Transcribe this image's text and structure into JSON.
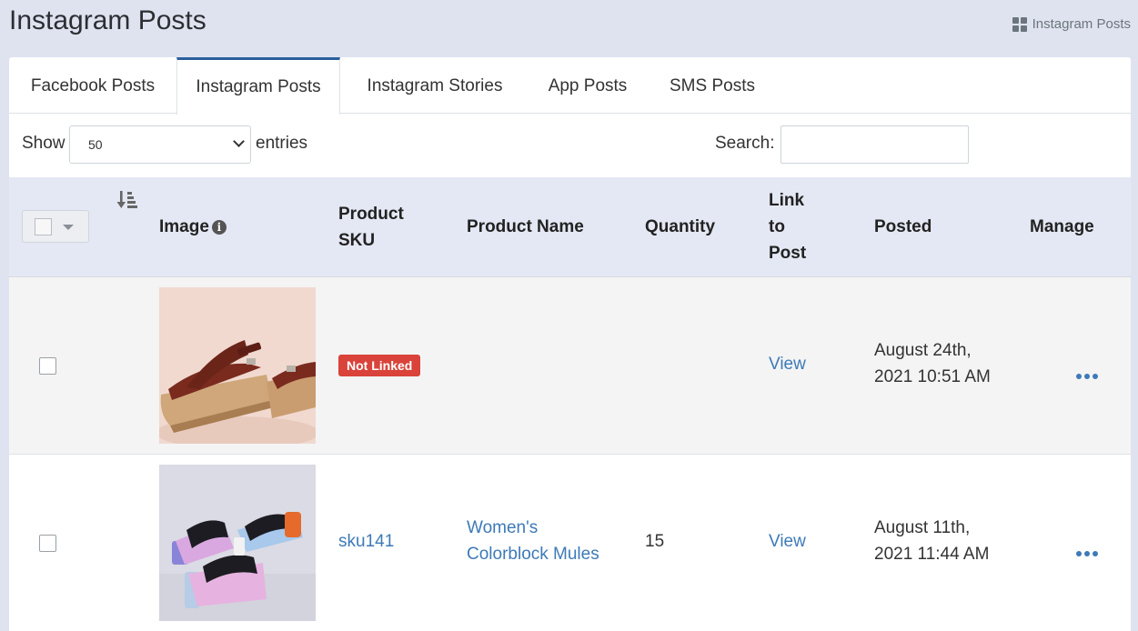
{
  "header": {
    "title": "Instagram Posts",
    "breadcrumb": "Instagram Posts",
    "breadcrumb_icon": "grid-icon"
  },
  "tabs": [
    {
      "label": "Facebook Posts",
      "active": false
    },
    {
      "label": "Instagram Posts",
      "active": true
    },
    {
      "label": "Instagram Stories",
      "active": false
    },
    {
      "label": "App Posts",
      "active": false
    },
    {
      "label": "SMS Posts",
      "active": false
    }
  ],
  "controls": {
    "show_label": "Show",
    "page_size": "50",
    "entries_label": "entries",
    "search_label": "Search:",
    "search_value": ""
  },
  "table": {
    "columns": {
      "image": "Image",
      "sku_line1": "Product",
      "sku_line2": "SKU",
      "name": "Product Name",
      "quantity": "Quantity",
      "link_line1": "Link",
      "link_line2": "to",
      "link_line3": "Post",
      "posted": "Posted",
      "manage": "Manage"
    },
    "rows": [
      {
        "image": "brown leather platform sandals",
        "sku_badge": "Not Linked",
        "sku": "",
        "product_name_line1": "",
        "product_name_line2": "",
        "quantity": "",
        "link": "View",
        "posted_line1": "August 24th,",
        "posted_line2": "2021 10:51 AM"
      },
      {
        "image": "pastel colorblock mules",
        "sku_badge": "",
        "sku": "sku141",
        "product_name_line1": "Women's",
        "product_name_line2": "Colorblock Mules",
        "quantity": "15",
        "link": "View",
        "posted_line1": "August 11th,",
        "posted_line2": "2021 11:44 AM"
      }
    ]
  },
  "colors": {
    "accent": "#2c5f9e",
    "link": "#3d7ab8",
    "badge_danger": "#d9433a",
    "header_bg": "#e4e8f4"
  }
}
